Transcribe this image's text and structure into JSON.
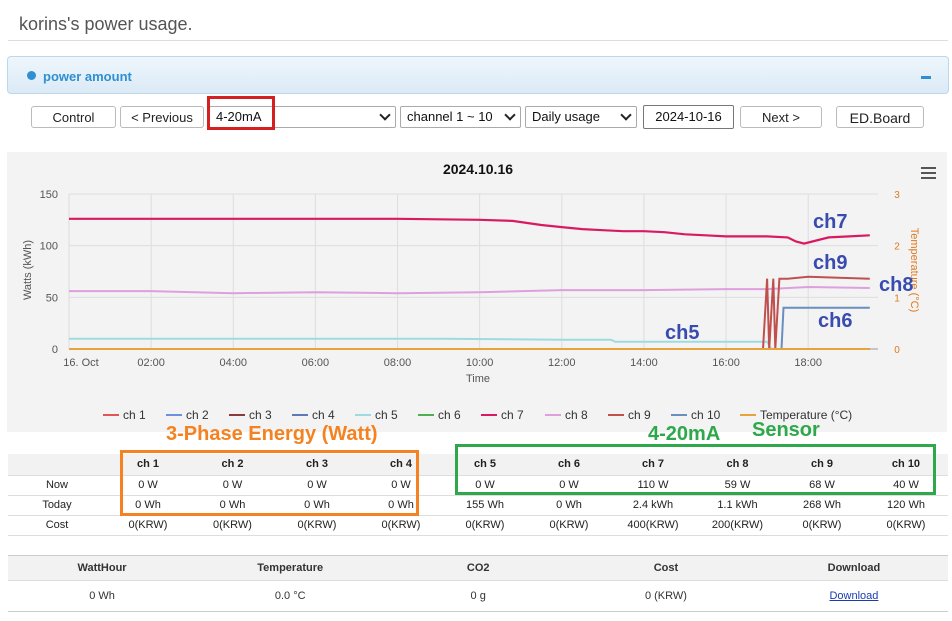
{
  "page": {
    "title": "korins's power usage."
  },
  "panel": {
    "title": "power amount"
  },
  "toolbar": {
    "control_label": "Control",
    "previous_label": "< Previous",
    "type_select": "4-20mA",
    "channel_select": "channel 1 ~ 10",
    "period_select": "Daily usage",
    "date_value": "2024-10-16",
    "next_label": "Next >",
    "edboard_label": "ED.Board"
  },
  "chart_data": {
    "type": "line",
    "title": "2024.10.16",
    "xlabel": "Time",
    "ylabel": "Watts (kWh)",
    "y2label": "Temperature (°C)",
    "ylim": [
      0,
      150
    ],
    "y2lim": [
      0,
      3
    ],
    "yticks": [
      "0",
      "50",
      "100",
      "150"
    ],
    "y2ticks": [
      "0",
      "1",
      "2",
      "3"
    ],
    "xticks": [
      "16. Oct",
      "02:00",
      "04:00",
      "06:00",
      "08:00",
      "10:00",
      "12:00",
      "14:00",
      "16:00",
      "18:00"
    ],
    "x_hours": [
      0,
      2,
      4,
      6,
      8,
      10,
      12,
      14,
      16,
      18
    ],
    "grid": true,
    "legend_position": "bottom",
    "series": [
      {
        "name": "ch 1",
        "color": "#e05555",
        "x": [
          0,
          19.5
        ],
        "y": [
          0,
          0
        ]
      },
      {
        "name": "ch 2",
        "color": "#6f8fe0",
        "x": [
          0,
          19.5
        ],
        "y": [
          0,
          0
        ]
      },
      {
        "name": "ch 3",
        "color": "#8b3a3a",
        "x": [
          0,
          19.5
        ],
        "y": [
          0,
          0
        ]
      },
      {
        "name": "ch 4",
        "color": "#5b7bb5",
        "x": [
          0,
          19.5
        ],
        "y": [
          0,
          0
        ]
      },
      {
        "name": "ch 5",
        "color": "#9edbe0",
        "x": [
          0,
          3,
          6,
          9,
          12,
          13.2,
          13.3,
          16,
          17.0,
          17.1,
          19.5
        ],
        "y": [
          10,
          10,
          10,
          10,
          9,
          9,
          7,
          7,
          7,
          0,
          0
        ]
      },
      {
        "name": "ch 6",
        "color": "#4caf50",
        "x": [
          0,
          19.5
        ],
        "y": [
          0,
          0
        ]
      },
      {
        "name": "ch 7",
        "color": "#d81b60",
        "x": [
          0,
          2,
          4,
          6,
          8,
          10,
          10.8,
          11.5,
          12,
          12.5,
          13,
          13.5,
          14,
          14.5,
          15,
          15.5,
          16,
          16.5,
          17,
          17.5,
          17.7,
          17.9,
          18.1,
          18.5,
          19,
          19.5
        ],
        "y": [
          126,
          126,
          126,
          126,
          126,
          125,
          124,
          120,
          118,
          116,
          115,
          114,
          114,
          113,
          111,
          110,
          109,
          109,
          109,
          108,
          104,
          102,
          104,
          108,
          109,
          110
        ]
      },
      {
        "name": "ch 8",
        "color": "#dda0dd",
        "x": [
          0,
          2,
          4,
          6,
          8,
          10,
          12,
          14,
          16,
          17,
          18,
          19.5
        ],
        "y": [
          56,
          56,
          54,
          55,
          54,
          55,
          57,
          57,
          58,
          58,
          60,
          59
        ]
      },
      {
        "name": "ch 9",
        "color": "#c0504d",
        "x": [
          0,
          16.9,
          17.0,
          17.05,
          17.15,
          17.2,
          17.3,
          17.5,
          18,
          19.5
        ],
        "y": [
          0,
          0,
          68,
          0,
          68,
          0,
          68,
          68,
          70,
          68
        ]
      },
      {
        "name": "ch 10",
        "color": "#6a8ec0",
        "x": [
          0,
          17.35,
          17.4,
          19.5
        ],
        "y": [
          0,
          0,
          40,
          40
        ]
      },
      {
        "name": "Temperature (°C)",
        "color": "#e8a33c",
        "x": [
          0,
          19.5
        ],
        "y": [
          0,
          0
        ]
      }
    ]
  },
  "annotations": {
    "three_phase": "3-Phase Energy (Watt)",
    "ma": "4-20mA",
    "sensor": "Sensor",
    "ch7": "ch7",
    "ch9": "ch9",
    "ch8": "ch8",
    "ch6": "ch6",
    "ch5": "ch5",
    "orange": "#f58220",
    "green": "#2ea84a",
    "label_color": "#3a4bb0"
  },
  "table": {
    "columns": [
      "ch 1",
      "ch 2",
      "ch 3",
      "ch 4",
      "ch 5",
      "ch 6",
      "ch 7",
      "ch 8",
      "ch 9",
      "ch 10"
    ],
    "rows": [
      {
        "label": "Now",
        "values": [
          "0 W",
          "0 W",
          "0 W",
          "0 W",
          "0 W",
          "0 W",
          "110 W",
          "59 W",
          "68 W",
          "40 W"
        ]
      },
      {
        "label": "Today",
        "values": [
          "0 Wh",
          "0 Wh",
          "0 Wh",
          "0 Wh",
          "155 Wh",
          "0 Wh",
          "2.4 kWh",
          "1.1 kWh",
          "268 Wh",
          "120 Wh"
        ]
      },
      {
        "label": "Cost",
        "values": [
          "0(KRW)",
          "0(KRW)",
          "0(KRW)",
          "0(KRW)",
          "0(KRW)",
          "0(KRW)",
          "400(KRW)",
          "200(KRW)",
          "0(KRW)",
          "0(KRW)"
        ]
      }
    ]
  },
  "summary": {
    "headers": [
      "WattHour",
      "Temperature",
      "CO2",
      "Cost",
      "Download"
    ],
    "values": [
      "0 Wh",
      "0.0 °C",
      "0 g",
      "0 (KRW)"
    ],
    "download_label": "Download"
  }
}
